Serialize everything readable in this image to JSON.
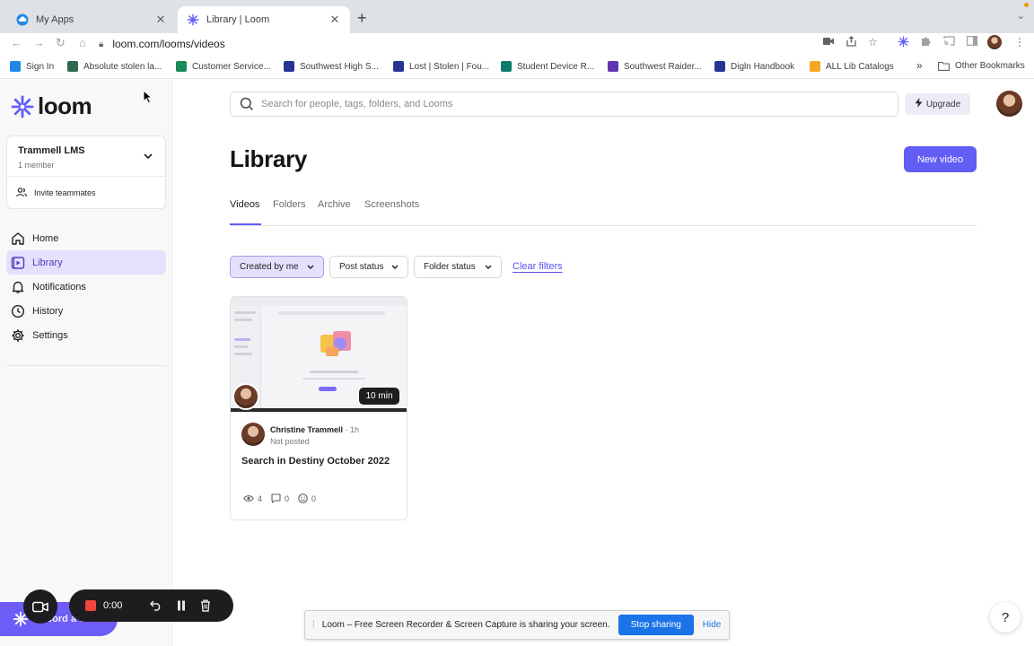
{
  "browser": {
    "tabs": [
      {
        "title": "My Apps",
        "active": false
      },
      {
        "title": "Library | Loom",
        "active": true
      }
    ],
    "url": "loom.com/looms/videos",
    "bookmarks": [
      {
        "label": "Sign In",
        "color": "#1f88e5"
      },
      {
        "label": "Absolute stolen la...",
        "color": "#2d6a4f"
      },
      {
        "label": "Customer Service...",
        "color": "#1b8a5a"
      },
      {
        "label": "Southwest High S...",
        "color": "#283593"
      },
      {
        "label": "Lost | Stolen | Fou...",
        "color": "#283593"
      },
      {
        "label": "Student Device R...",
        "color": "#0f7b6c"
      },
      {
        "label": "Southwest Raider...",
        "color": "#5e35b1"
      },
      {
        "label": "Digln Handbook",
        "color": "#283593"
      },
      {
        "label": "ALL Lib Catalogs",
        "color": "#f5a623"
      }
    ],
    "other_bookmarks": "Other Bookmarks",
    "more": "»"
  },
  "sidebar": {
    "logo_text": "loom",
    "workspace": {
      "name": "Trammell LMS",
      "members": "1 member",
      "invite": "Invite teammates"
    },
    "nav": [
      {
        "label": "Home",
        "icon": "home-icon",
        "active": false
      },
      {
        "label": "Library",
        "icon": "library-icon",
        "active": true
      },
      {
        "label": "Notifications",
        "icon": "bell-icon",
        "active": false
      },
      {
        "label": "History",
        "icon": "clock-icon",
        "active": false
      },
      {
        "label": "Settings",
        "icon": "gear-icon",
        "active": false
      }
    ],
    "record_label": "Record a video"
  },
  "header": {
    "search_placeholder": "Search for people, tags, folders, and Looms",
    "upgrade_label": "Upgrade"
  },
  "main": {
    "title": "Library",
    "new_video_label": "New video",
    "tabs": [
      {
        "label": "Videos",
        "active": true
      },
      {
        "label": "Folders",
        "active": false
      },
      {
        "label": "Archive",
        "active": false
      },
      {
        "label": "Screenshots",
        "active": false
      }
    ],
    "filters": [
      {
        "label": "Created by me",
        "active": true
      },
      {
        "label": "Post status",
        "active": false
      },
      {
        "label": "Folder status",
        "active": false
      }
    ],
    "clear_filters": "Clear filters",
    "videos": [
      {
        "duration": "10 min",
        "author": "Christine Trammell",
        "time": "· 1h",
        "status": "Not posted",
        "title": "Search in Destiny October 2022",
        "views": "4",
        "comments": "0",
        "reactions": "0"
      }
    ]
  },
  "recorder": {
    "time": "0:00"
  },
  "share_banner": {
    "text": "Loom – Free Screen Recorder & Screen Capture is sharing your screen.",
    "stop_label": "Stop sharing",
    "hide_label": "Hide"
  },
  "help_label": "?",
  "colors": {
    "accent": "#625df5",
    "active_nav_bg": "#e6e0fd",
    "stop_share": "#1a73e8",
    "rec_stop": "#f2453d"
  }
}
